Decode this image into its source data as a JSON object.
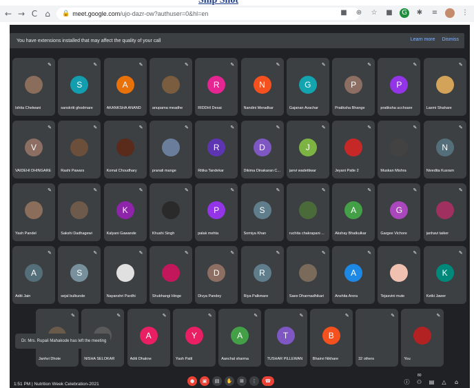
{
  "banner": {
    "text": "Snip Shot"
  },
  "browser": {
    "url_host": "meet.google.com",
    "url_path": "/ujo-dazr-ow?authuser=0&hl=en"
  },
  "extension_bar": {
    "message": "You have extensions installed that may affect the quality of your call",
    "learn_more": "Learn more",
    "dismiss": "Dismiss"
  },
  "participants": [
    {
      "name": "Ishita Chelwani",
      "initial": "",
      "color": "#8a6d5a"
    },
    {
      "name": "sanskriti ghodmare",
      "initial": "S",
      "color": "#129eaf"
    },
    {
      "name": "AKANKSHA ANAND",
      "initial": "A",
      "color": "#e8710a"
    },
    {
      "name": "anupama meadhe",
      "initial": "",
      "color": "#7a5c3e"
    },
    {
      "name": "RIDDHI Desai",
      "initial": "R",
      "color": "#e52592"
    },
    {
      "name": "Nandini Meradkar",
      "initial": "N",
      "color": "#f4511e"
    },
    {
      "name": "Gajanan Avachar",
      "initial": "G",
      "color": "#12a4af"
    },
    {
      "name": "Pratiksha Bhange",
      "initial": "P",
      "color": "#8d6e63"
    },
    {
      "name": "pratiksha ucchsare",
      "initial": "P",
      "color": "#9334e6"
    },
    {
      "name": "Laxmi Shahare",
      "initial": "",
      "color": "#d4a35a"
    },
    {
      "name": "VAIDEHI DHINGARE",
      "initial": "V",
      "color": "#8d6e63"
    },
    {
      "name": "Rashi Pawars",
      "initial": "",
      "color": "#6b4f3a"
    },
    {
      "name": "Komal Choudhary",
      "initial": "",
      "color": "#5a2a1a"
    },
    {
      "name": "pranali mange",
      "initial": "",
      "color": "#6a7d9a"
    },
    {
      "name": "Ritika Tandekar",
      "initial": "R",
      "color": "#5e35b1"
    },
    {
      "name": "Dikima Dinakaran C...",
      "initial": "D",
      "color": "#7e57c2"
    },
    {
      "name": "janvi wadettiwar",
      "initial": "J",
      "color": "#7cb342"
    },
    {
      "name": "Jeyani Patle 2",
      "initial": "",
      "color": "#c62828"
    },
    {
      "name": "Muskan Mishra",
      "initial": "",
      "color": "#424242"
    },
    {
      "name": "Nivedita Kusram",
      "initial": "N",
      "color": "#546e7a"
    },
    {
      "name": "Yash Pandel",
      "initial": "",
      "color": "#8a6d5a"
    },
    {
      "name": "Sakshi Dadhagewi",
      "initial": "",
      "color": "#6d5a4a"
    },
    {
      "name": "Kalyani Gawande",
      "initial": "K",
      "color": "#8e24aa"
    },
    {
      "name": "Khushi Singh",
      "initial": "",
      "color": "#2a2a2a"
    },
    {
      "name": "palak mehta",
      "initial": "P",
      "color": "#9334e6"
    },
    {
      "name": "Somiya Khan",
      "initial": "S",
      "color": "#607d8b"
    },
    {
      "name": "ruchita chakrapani ...",
      "initial": "",
      "color": "#4a6a3a"
    },
    {
      "name": "Akshay Bhatkulkar",
      "initial": "A",
      "color": "#43a047"
    },
    {
      "name": "Gargee Vichore",
      "initial": "G",
      "color": "#ab47bc"
    },
    {
      "name": "janhavi taiker",
      "initial": "",
      "color": "#a03060"
    },
    {
      "name": "Aditi Jain",
      "initial": "A",
      "color": "#546e7a"
    },
    {
      "name": "sejal bulkunde",
      "initial": "S",
      "color": "#78909c"
    },
    {
      "name": "Nayanshri Pardhi",
      "initial": "",
      "color": "#e0e0e0"
    },
    {
      "name": "Shubhangi Hinge",
      "initial": "",
      "color": "#c2185b"
    },
    {
      "name": "Divya Pandey",
      "initial": "D",
      "color": "#8d6e63"
    },
    {
      "name": "Riya Palkmare",
      "initial": "R",
      "color": "#607d8b"
    },
    {
      "name": "Saee Dharmadhikari",
      "initial": "",
      "color": "#7a6a5a"
    },
    {
      "name": "Anshita Arora",
      "initial": "A",
      "color": "#1e88e5"
    },
    {
      "name": "Tejasvini mute",
      "initial": "",
      "color": "#f0c0b0"
    },
    {
      "name": "Ketki Jawer",
      "initial": "K",
      "color": "#00897b"
    },
    {
      "name": "Janhvi Dhote",
      "initial": "",
      "color": "#6a5a4a"
    },
    {
      "name": "NISHA SELOKAR",
      "initial": "",
      "color": "#5a5a5a"
    },
    {
      "name": "Aditi Dhakne",
      "initial": "A",
      "color": "#e91e63"
    },
    {
      "name": "Yash Patil",
      "initial": "Y",
      "color": "#e91e63"
    },
    {
      "name": "Aanchal sharma",
      "initial": "A",
      "color": "#43a047"
    },
    {
      "name": "TUSHAR PILLEWAN",
      "initial": "T",
      "color": "#7e57c2"
    },
    {
      "name": "Bhairvi Nikhare",
      "initial": "B",
      "color": "#f4511e"
    },
    {
      "name": "32 others",
      "initial": "",
      "color": "#3c4043"
    },
    {
      "name": "You",
      "initial": "",
      "color": "#b22222"
    }
  ],
  "toast": "Dr. Mrs. Rupali Mahakode has left the meeting",
  "meeting": {
    "time": "1:51 PM",
    "separator": "|",
    "title": "Nutrition Week Celebration-2021"
  },
  "badge_count": "80"
}
